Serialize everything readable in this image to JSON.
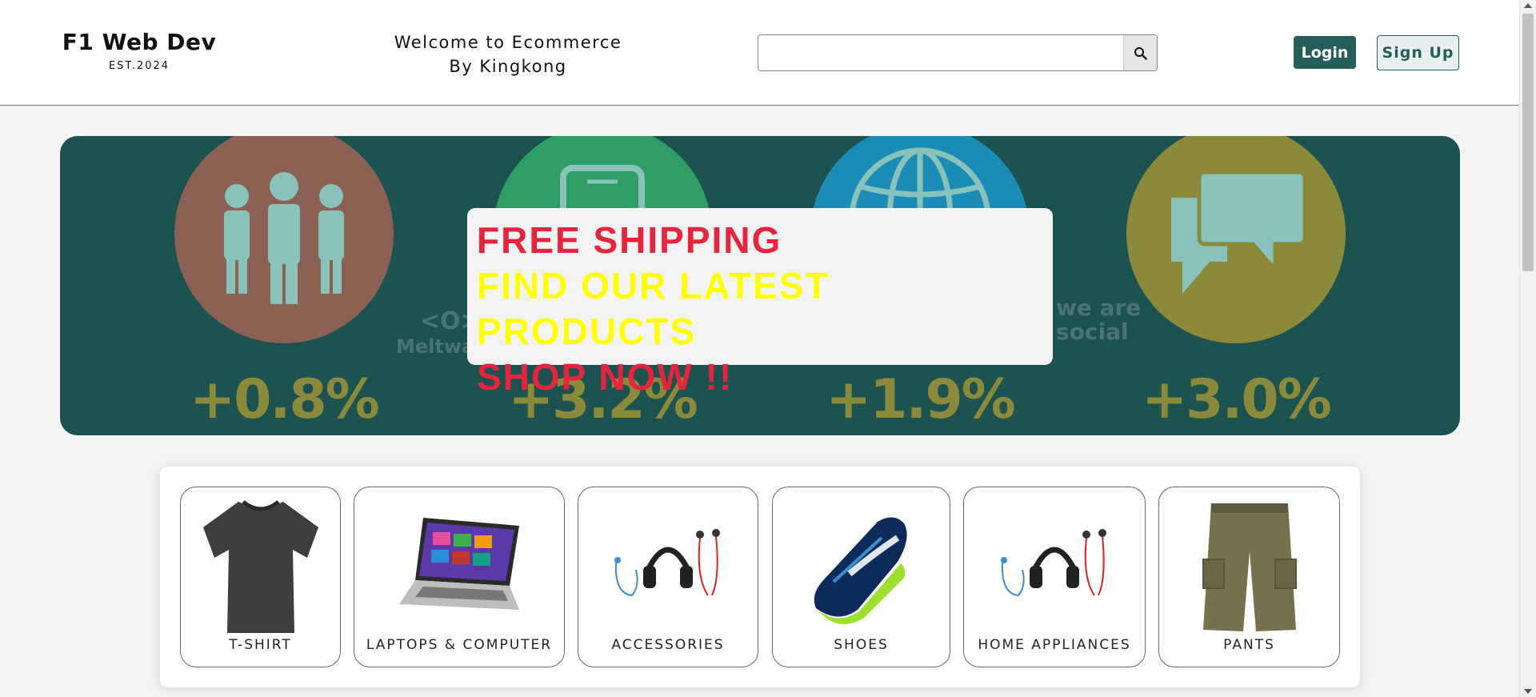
{
  "header": {
    "brand_name": "F1 Web Dev",
    "brand_est": "EST.2024",
    "welcome_line1": "Welcome to Ecommerce",
    "welcome_line2": "By Kingkong",
    "search": {
      "value": "",
      "placeholder": "",
      "icon": "search-icon"
    },
    "login_label": "Login",
    "signup_label": "Sign Up"
  },
  "hero": {
    "stats": [
      {
        "value": "+0.8%",
        "icon": "people-icon",
        "circle_color": "#8a6152"
      },
      {
        "value": "+3.2%",
        "icon": "smartphone-icon",
        "circle_color": "#2e9e64"
      },
      {
        "value": "+1.9%",
        "icon": "globe-icon",
        "circle_color": "#1b8cb5"
      },
      {
        "value": "+3.0%",
        "icon": "chat-bubbles-icon",
        "circle_color": "#8a8a3a"
      }
    ],
    "watermarks": [
      "Meltwat",
      "we are social"
    ],
    "promo": {
      "line1": "FREE SHIPPING",
      "line2": "FIND OUR LATEST PRODUCTS",
      "line3": "SHOP NOW !!",
      "line1_color": "#e8243c",
      "line2_color": "#ffff00",
      "line3_color": "#e8243c"
    }
  },
  "categories": [
    {
      "label": "T-SHIRT",
      "icon": "tshirt-image"
    },
    {
      "label": "LAPTOPS & COMPUTER",
      "icon": "laptop-image"
    },
    {
      "label": "ACCESSORIES",
      "icon": "headphones-image"
    },
    {
      "label": "SHOES",
      "icon": "shoe-image"
    },
    {
      "label": "HOME APPLIANCES",
      "icon": "headphones-image"
    },
    {
      "label": "PANTS",
      "icon": "pants-image"
    }
  ],
  "colors": {
    "brand": "#245e5a",
    "hero_bg": "#1c5250",
    "page_bg": "#f3f3f3"
  }
}
